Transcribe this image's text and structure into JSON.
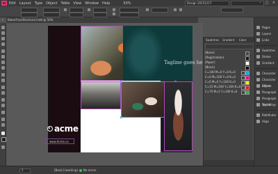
{
  "app": {
    "logo": "Id",
    "menu": [
      "Edit",
      "Layout",
      "Type",
      "Object",
      "Table",
      "View",
      "Window",
      "Help"
    ],
    "zoom": "50%",
    "workspace": "Design 20151217",
    "window_controls": "– □ ×"
  },
  "document_tab": {
    "title": "BakerFinal-Brochure.indd @ 50%"
  },
  "canvas": {
    "tagline": "Tagline goes here.",
    "logo_word": "acme",
    "url": "www.Acme.co"
  },
  "layers_panel": {
    "tabs": [
      "Swatches",
      "Gradient",
      "Color"
    ],
    "swatches": [
      "[None]",
      "[Registration]",
      "[Paper]",
      "[Black]",
      "C=100 M=0 Y=0 K=0",
      "C=0 M=100 Y=0 K=0",
      "C=0 M=0 Y=100 K=0",
      "C=15 M=100 Y=100 K=0",
      "C=75 M=5 Y=100 K=0"
    ]
  },
  "dock": {
    "group1": [
      "Pages",
      "Layers",
      "Links"
    ],
    "group2": [
      "Swatches",
      "Stroke",
      "Gradient"
    ],
    "group3": [
      "Character",
      "Character Styles",
      "Effects",
      "Paragraph",
      "Paragraph Styles",
      "Text Wrap"
    ],
    "group4": [
      "Pathfinder",
      "Align"
    ]
  },
  "status": {
    "page": "1",
    "master": "[Basic] (working)",
    "preflight": "No errors"
  }
}
